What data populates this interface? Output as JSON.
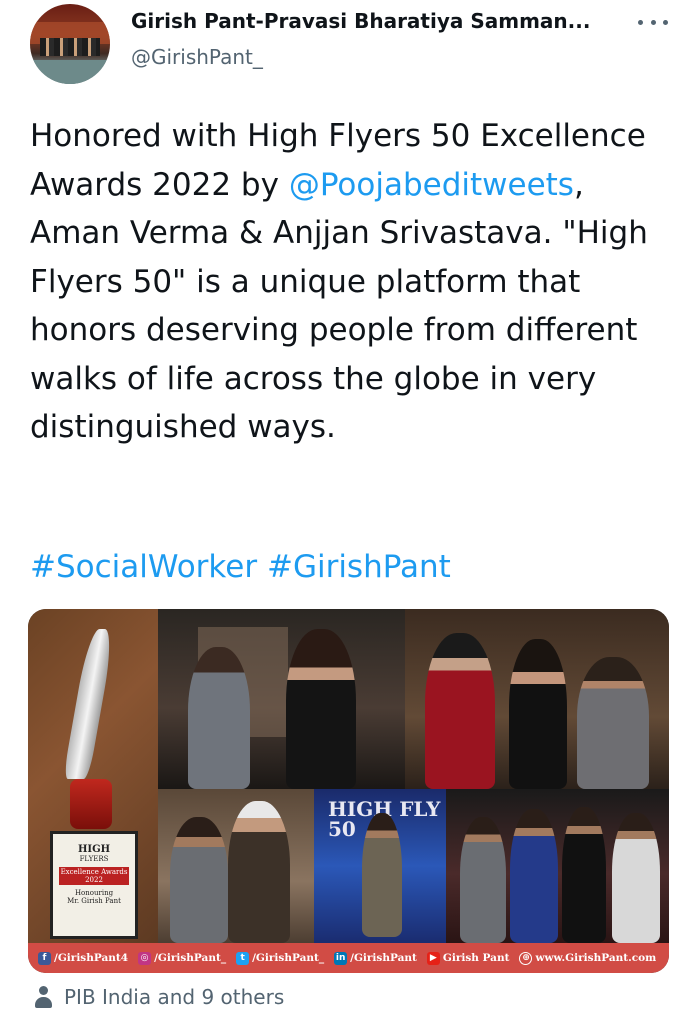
{
  "author": {
    "name": "Girish Pant-Pravasi Bharatiya Samman...",
    "handle": "@GirishPant_"
  },
  "tweet": {
    "text_before": "Honored with High Flyers 50 Excellence Awards 2022 by ",
    "mention": "@Poojabeditweets",
    "text_after": ", Aman Verma & Anjjan Srivastava. \"High Flyers 50\" is a unique platform that honors deserving people from different walks of life across the globe in very distinguished ways.",
    "hashtags": [
      "#SocialWorker",
      "#GirishPant"
    ]
  },
  "media": {
    "plaque": {
      "line1": "HIGH",
      "line2": "FLYERS",
      "award": "Excellence Awards 2022",
      "honoring": "Honouring",
      "recipient": "Mr. Girish Pant"
    },
    "backdrop_text": "HIGH FLY 50",
    "social_links": [
      {
        "icon": "facebook-icon",
        "glyph": "f",
        "color": "#3b5998",
        "label": "/GirishPant4"
      },
      {
        "icon": "instagram-icon",
        "glyph": "◎",
        "color": "#c13584",
        "label": "/GirishPant_"
      },
      {
        "icon": "twitter-icon",
        "glyph": "t",
        "color": "#1da1f2",
        "label": "/GirishPant_"
      },
      {
        "icon": "linkedin-icon",
        "glyph": "in",
        "color": "#0077b5",
        "label": "/GirishPant"
      },
      {
        "icon": "youtube-icon",
        "glyph": "▶",
        "color": "#e62117",
        "label": "Girish Pant"
      },
      {
        "icon": "globe-icon",
        "glyph": "⊕",
        "color": "#d14c45",
        "label": "www.GirishPant.com"
      }
    ]
  },
  "footer": {
    "likes_text": "PIB India and 9 others"
  }
}
